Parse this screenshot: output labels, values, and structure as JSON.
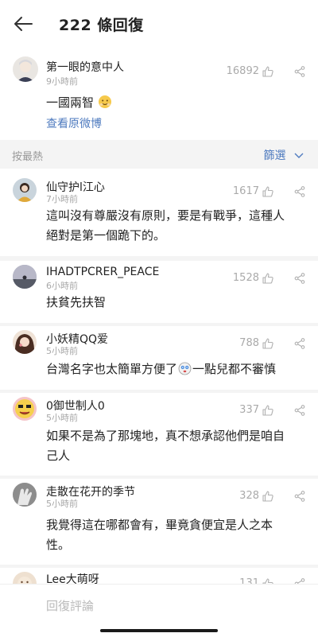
{
  "header": {
    "title": "222 條回復"
  },
  "post": {
    "author": "第一眼的意中人",
    "time": "9小時前",
    "likes": "16892",
    "text": "一國兩智",
    "link": "查看原微博"
  },
  "sortbar": {
    "sort_label": "按最熱",
    "filter_label": "篩選"
  },
  "comments": [
    {
      "author": "仙守护l江心",
      "time": "7小時前",
      "likes": "1617",
      "lines": [
        "這叫沒有尊嚴沒有原則，要是有戰爭，這種人",
        "絕對是第一個跪下的。"
      ]
    },
    {
      "author": "IHADTPCRER_PEACE",
      "time": "6小時前",
      "likes": "1528",
      "lines": [
        "扶貧先扶智"
      ]
    },
    {
      "author": "小妖精QQ爱",
      "time": "5小時前",
      "likes": "788",
      "lines": [
        "台灣名字也太簡單方便了",
        "一點兒都不審慎"
      ]
    },
    {
      "author": "0御世制人0",
      "time": "5小時前",
      "likes": "337",
      "lines": [
        "如果不是為了那塊地，真不想承認他們是咱自",
        "己人"
      ]
    },
    {
      "author": "走散在花开的季节",
      "time": "5小時前",
      "likes": "328",
      "lines": [
        "我覺得這在哪都會有，畢竟貪便宜是人之本",
        "性。"
      ]
    },
    {
      "author": "Lee大萌呀",
      "time": "",
      "likes": "131",
      "lines": []
    }
  ],
  "footer": {
    "reply_placeholder": "回復評論"
  },
  "colors": {
    "accent": "#4f7bbf",
    "muted": "#aaaaaa",
    "divider": "#f4f4f4"
  }
}
